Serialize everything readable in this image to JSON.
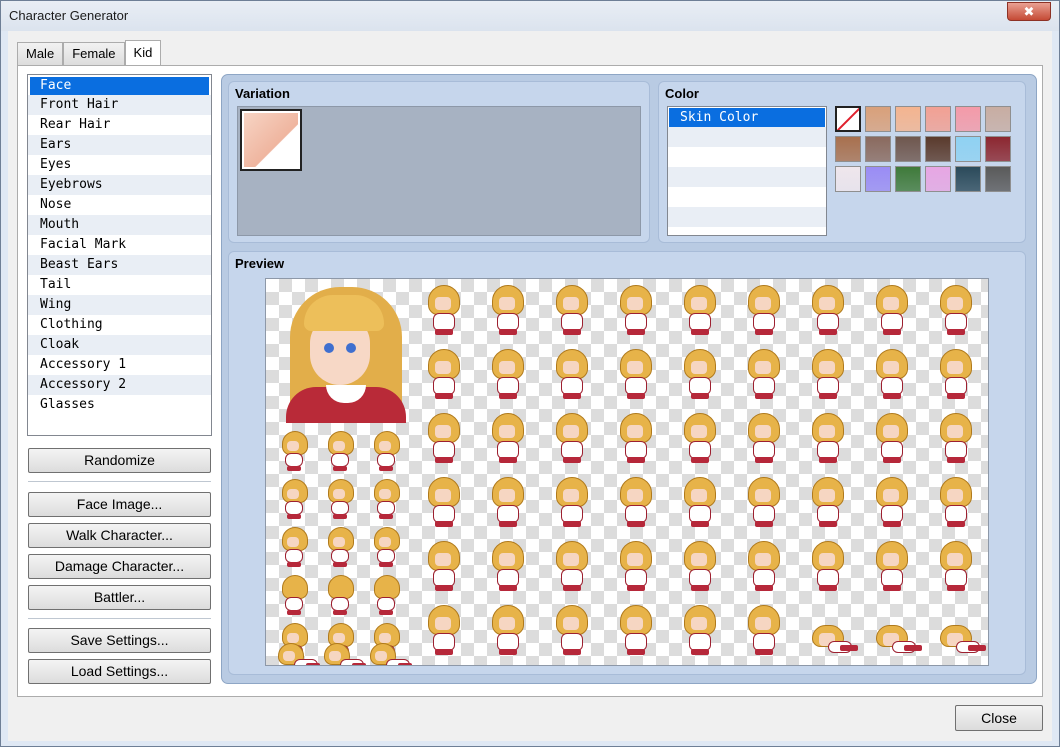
{
  "window": {
    "title": "Character Generator",
    "close_glyph": "✖"
  },
  "tabs": [
    {
      "label": "Male",
      "active": false
    },
    {
      "label": "Female",
      "active": false
    },
    {
      "label": "Kid",
      "active": true
    }
  ],
  "parts": {
    "selected": "Face",
    "items": [
      "Face",
      "Front Hair",
      "Rear Hair",
      "Ears",
      "Eyes",
      "Eyebrows",
      "Nose",
      "Mouth",
      "Facial Mark",
      "Beast Ears",
      "Tail",
      "Wing",
      "Clothing",
      "Cloak",
      "Accessory 1",
      "Accessory 2",
      "Glasses"
    ]
  },
  "buttons": {
    "randomize": "Randomize",
    "face_image": "Face Image...",
    "walk_character": "Walk Character...",
    "damage_character": "Damage Character...",
    "battler": "Battler...",
    "save_settings": "Save Settings...",
    "load_settings": "Load Settings...",
    "close": "Close"
  },
  "variation": {
    "title": "Variation"
  },
  "color": {
    "title": "Color",
    "items": [
      "Skin Color",
      "",
      "",
      "",
      "",
      ""
    ],
    "selected": "Skin Color",
    "swatches": [
      "none",
      "#d9a07a",
      "#f4b48f",
      "#f2a093",
      "#f49aa8",
      "#c8ada2",
      "#a8704e",
      "#8a6a5e",
      "#6f574e",
      "#5a3a2c",
      "#8fd2f2",
      "#8c2730",
      "#efe6ec",
      "#9a8cf4",
      "#3f7a3a",
      "#e7a6e3",
      "#2b4a5a",
      "#5a5a5a"
    ]
  },
  "preview": {
    "title": "Preview"
  }
}
